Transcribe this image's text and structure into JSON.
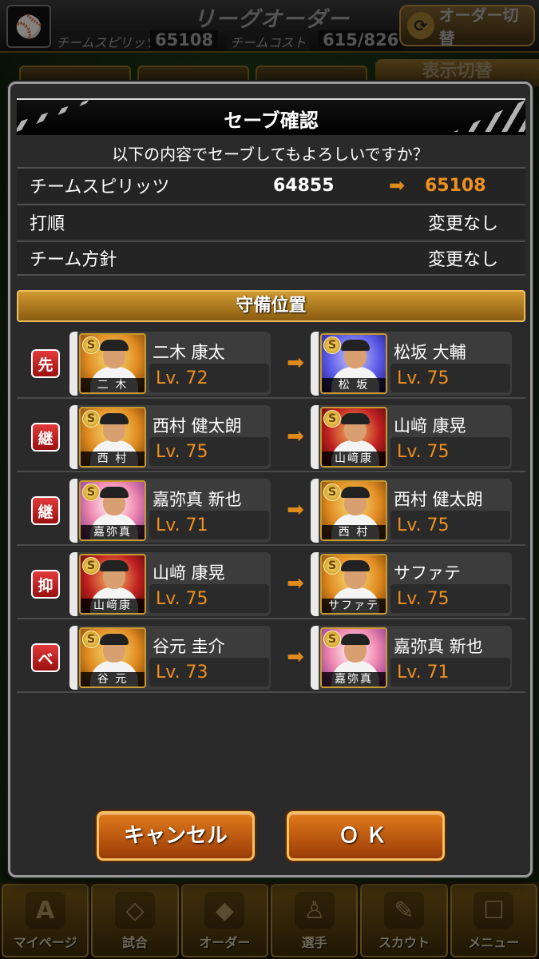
{
  "header": {
    "title": "リーグオーダー",
    "team_logo_icon": "giants-logo-icon",
    "team_spirits_label": "チームスピリッツ",
    "team_spirits_value": "65108",
    "team_cost_label": "チームコスト",
    "team_cost_value": "615/826",
    "order_switch_label": "オーダー切替",
    "view_switch_label": "表示切替"
  },
  "modal": {
    "title": "セーブ確認",
    "question": "以下の内容でセーブしてもよろしいですか？",
    "team_spirits": {
      "label": "チームスピリッツ",
      "old": "64855",
      "new": "65108"
    },
    "batting_order": {
      "label": "打順",
      "value": "変更なし"
    },
    "team_policy": {
      "label": "チーム方針",
      "value": "変更なし"
    },
    "section_title": "守備位置",
    "changes": [
      {
        "position": "先",
        "from": {
          "name": "二木 康太",
          "plate": "二 木",
          "level": "Lv. 72"
        },
        "to": {
          "name": "松坂 大輔",
          "plate": "松 坂",
          "level": "Lv. 75"
        }
      },
      {
        "position": "継",
        "from": {
          "name": "西村 健太朗",
          "plate": "西 村",
          "level": "Lv. 75"
        },
        "to": {
          "name": "山﨑 康晃",
          "plate": "山﨑康",
          "level": "Lv. 75"
        }
      },
      {
        "position": "継",
        "from": {
          "name": "嘉弥真 新也",
          "plate": "嘉弥真",
          "level": "Lv. 71"
        },
        "to": {
          "name": "西村 健太朗",
          "plate": "西 村",
          "level": "Lv. 75"
        }
      },
      {
        "position": "抑",
        "from": {
          "name": "山﨑 康晃",
          "plate": "山﨑康",
          "level": "Lv. 75"
        },
        "to": {
          "name": "サファテ",
          "plate": "サファテ",
          "level": "Lv. 75"
        }
      },
      {
        "position": "ベ",
        "from": {
          "name": "谷元 圭介",
          "plate": "谷 元",
          "level": "Lv. 73"
        },
        "to": {
          "name": "嘉弥真 新也",
          "plate": "嘉弥真",
          "level": "Lv. 71"
        }
      }
    ],
    "cancel_label": "キャンセル",
    "ok_label": "ＯＫ"
  },
  "bottom_nav": [
    {
      "label": "マイページ",
      "icon": "mypage-icon"
    },
    {
      "label": "試合",
      "icon": "stadium-icon"
    },
    {
      "label": "オーダー",
      "icon": "order-field-icon"
    },
    {
      "label": "選手",
      "icon": "player-icon"
    },
    {
      "label": "スカウト",
      "icon": "scout-icon"
    },
    {
      "label": "メニュー",
      "icon": "menu-character-icon"
    }
  ],
  "colors": {
    "accent_orange": "#f0901e",
    "badge_red": "#c02020",
    "gold_border": "#f4c060"
  }
}
